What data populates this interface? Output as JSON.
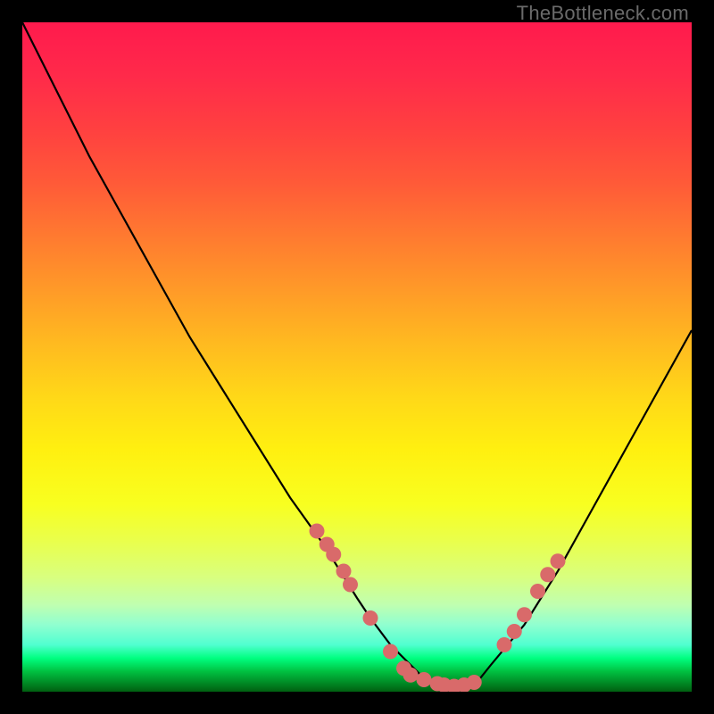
{
  "watermark": "TheBottleneck.com",
  "chart_data": {
    "type": "line",
    "title": "",
    "xlabel": "",
    "ylabel": "",
    "xlim": [
      0,
      100
    ],
    "ylim": [
      0,
      100
    ],
    "series": [
      {
        "name": "bottleneck-curve",
        "x": [
          0,
          5,
          10,
          15,
          20,
          25,
          30,
          35,
          40,
          45,
          50,
          52,
          55,
          58,
          60,
          62,
          65,
          68,
          70,
          75,
          80,
          85,
          90,
          95,
          100
        ],
        "values": [
          100,
          90,
          80,
          71,
          62,
          53,
          45,
          37,
          29,
          22,
          14,
          11,
          7,
          4,
          2,
          1,
          0.5,
          1.5,
          4,
          10,
          18,
          27,
          36,
          45,
          54
        ]
      },
      {
        "name": "highlight-points-left",
        "type": "scatter",
        "x": [
          44,
          45.5,
          46.5,
          48,
          49,
          52,
          55,
          57
        ],
        "values": [
          24,
          22,
          20.5,
          18,
          16,
          11,
          6,
          3.5
        ]
      },
      {
        "name": "highlight-points-bottom",
        "type": "scatter",
        "x": [
          58,
          60,
          62,
          63,
          64.5,
          66,
          67.5
        ],
        "values": [
          2.5,
          1.8,
          1.2,
          1.0,
          0.8,
          1.0,
          1.4
        ]
      },
      {
        "name": "highlight-points-right",
        "type": "scatter",
        "x": [
          72,
          73.5,
          75,
          77,
          78.5,
          80
        ],
        "values": [
          7,
          9,
          11.5,
          15,
          17.5,
          19.5
        ]
      }
    ],
    "colors": {
      "curve": "#000000",
      "points": "#d96a6a"
    }
  }
}
